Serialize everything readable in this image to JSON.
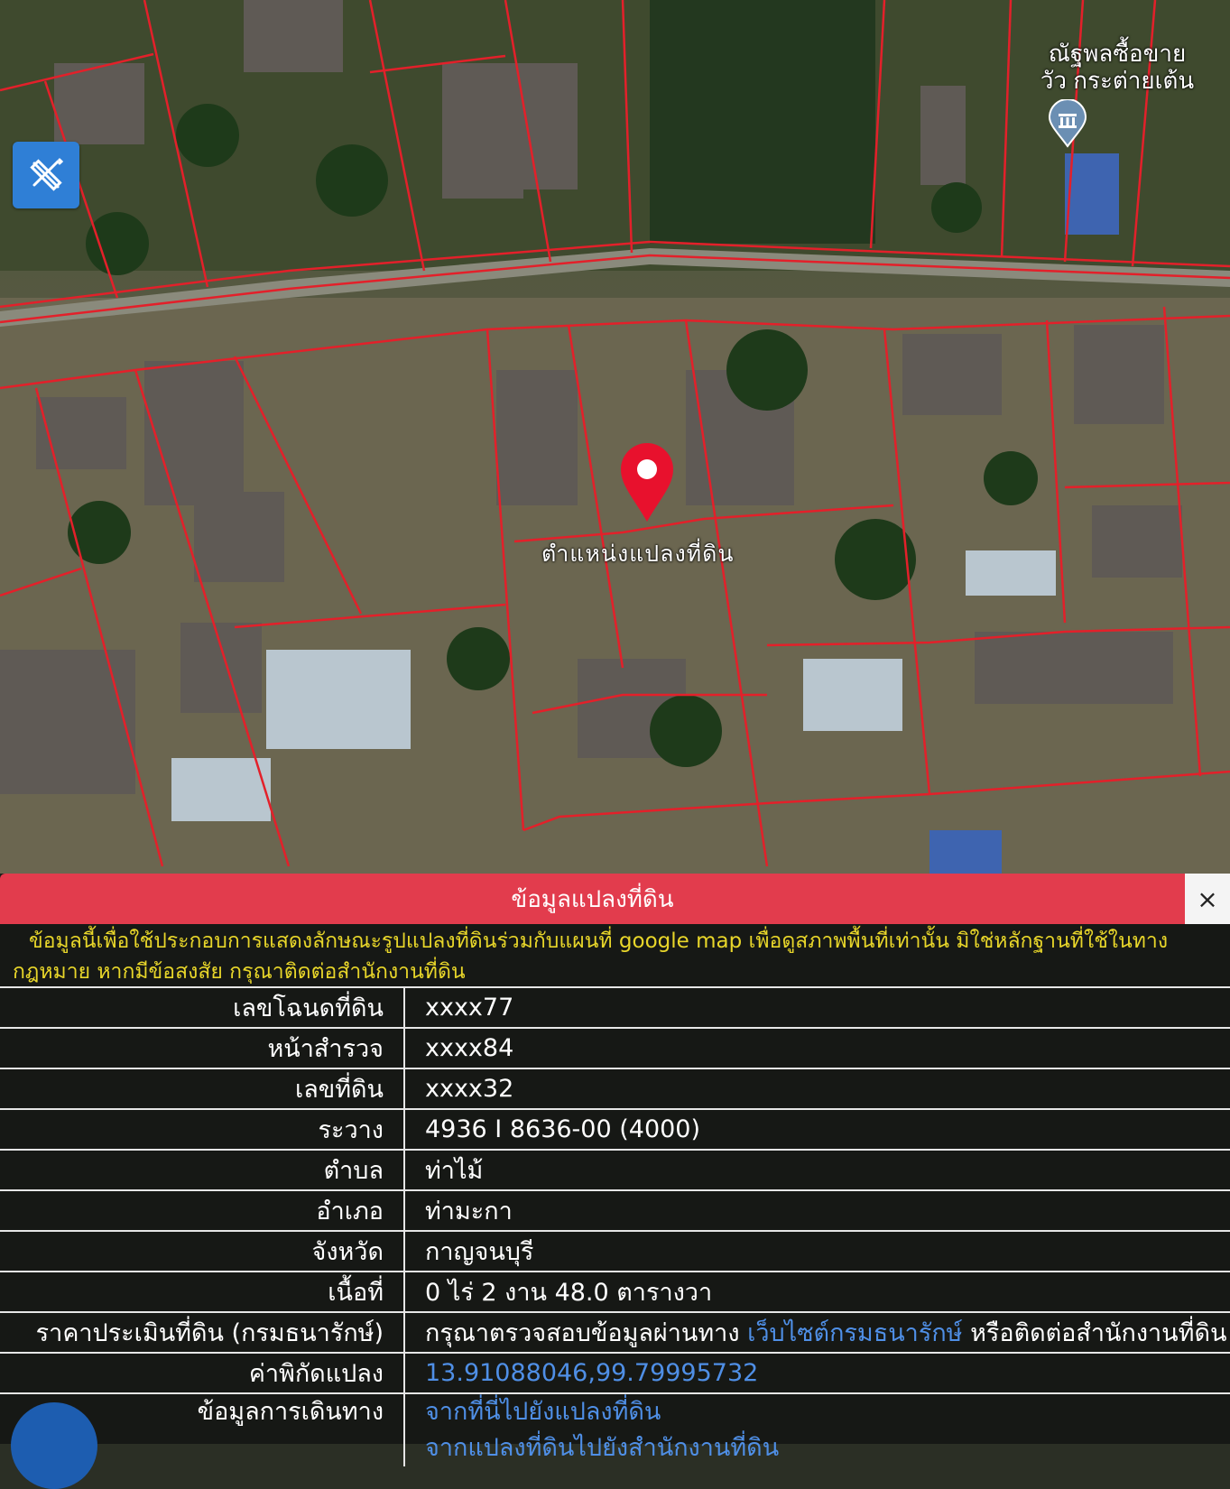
{
  "map": {
    "shop_label": "ณัฐพลซื้อขาย\nวัว กระต่ายเต้น",
    "pin_label": "ตำแหน่งแปลงที่ดิน",
    "tool_icon": "ruler-pencil-icon",
    "colors": {
      "parcel_line": "#e3202a",
      "road": "#8a8a7c",
      "pin": "#e8112d"
    }
  },
  "panel": {
    "title": "ข้อมูลแปลงที่ดิน",
    "close_label": "×",
    "disclaimer": "ข้อมูลนี้เพื่อใช้ประกอบการแสดงลักษณะรูปแปลงที่ดินร่วมกับแผนที่ google map เพื่อดูสภาพพื้นที่เท่านั้น มิใช่หลักฐานที่ใช้ในทางกฎหมาย หากมีข้อสงสัย กรุณาติดต่อสำนักงานที่ดิน",
    "rows": [
      {
        "label": "เลขโฉนดที่ดิน",
        "value": "xxxx77"
      },
      {
        "label": "หน้าสำรวจ",
        "value": "xxxx84"
      },
      {
        "label": "เลขที่ดิน",
        "value": "xxxx32"
      },
      {
        "label": "ระวาง",
        "value": "4936 I 8636-00 (4000)"
      },
      {
        "label": "ตำบล",
        "value": "ท่าไม้"
      },
      {
        "label": "อำเภอ",
        "value": "ท่ามะกา"
      },
      {
        "label": "จังหวัด",
        "value": "กาญจนบุรี"
      },
      {
        "label": "เนื้อที่",
        "value": "0 ไร่ 2 งาน 48.0 ตารางวา"
      }
    ],
    "appraisal": {
      "label": "ราคาประเมินที่ดิน (กรมธนารักษ์)",
      "prefix": "กรุณาตรวจสอบข้อมูลผ่านทาง",
      "link": "เว็บไซต์กรมธนารักษ์",
      "suffix": "หรือติดต่อสำนักงานที่ดิน"
    },
    "coords": {
      "label": "ค่าพิกัดแปลง",
      "value": "13.91088046,99.79995732"
    },
    "travel": {
      "label": "ข้อมูลการเดินทาง",
      "link1": "จากที่นี่ไปยังแปลงที่ดิน",
      "link2": "จากแปลงที่ดินไปยังสำนักงานที่ดิน"
    }
  }
}
